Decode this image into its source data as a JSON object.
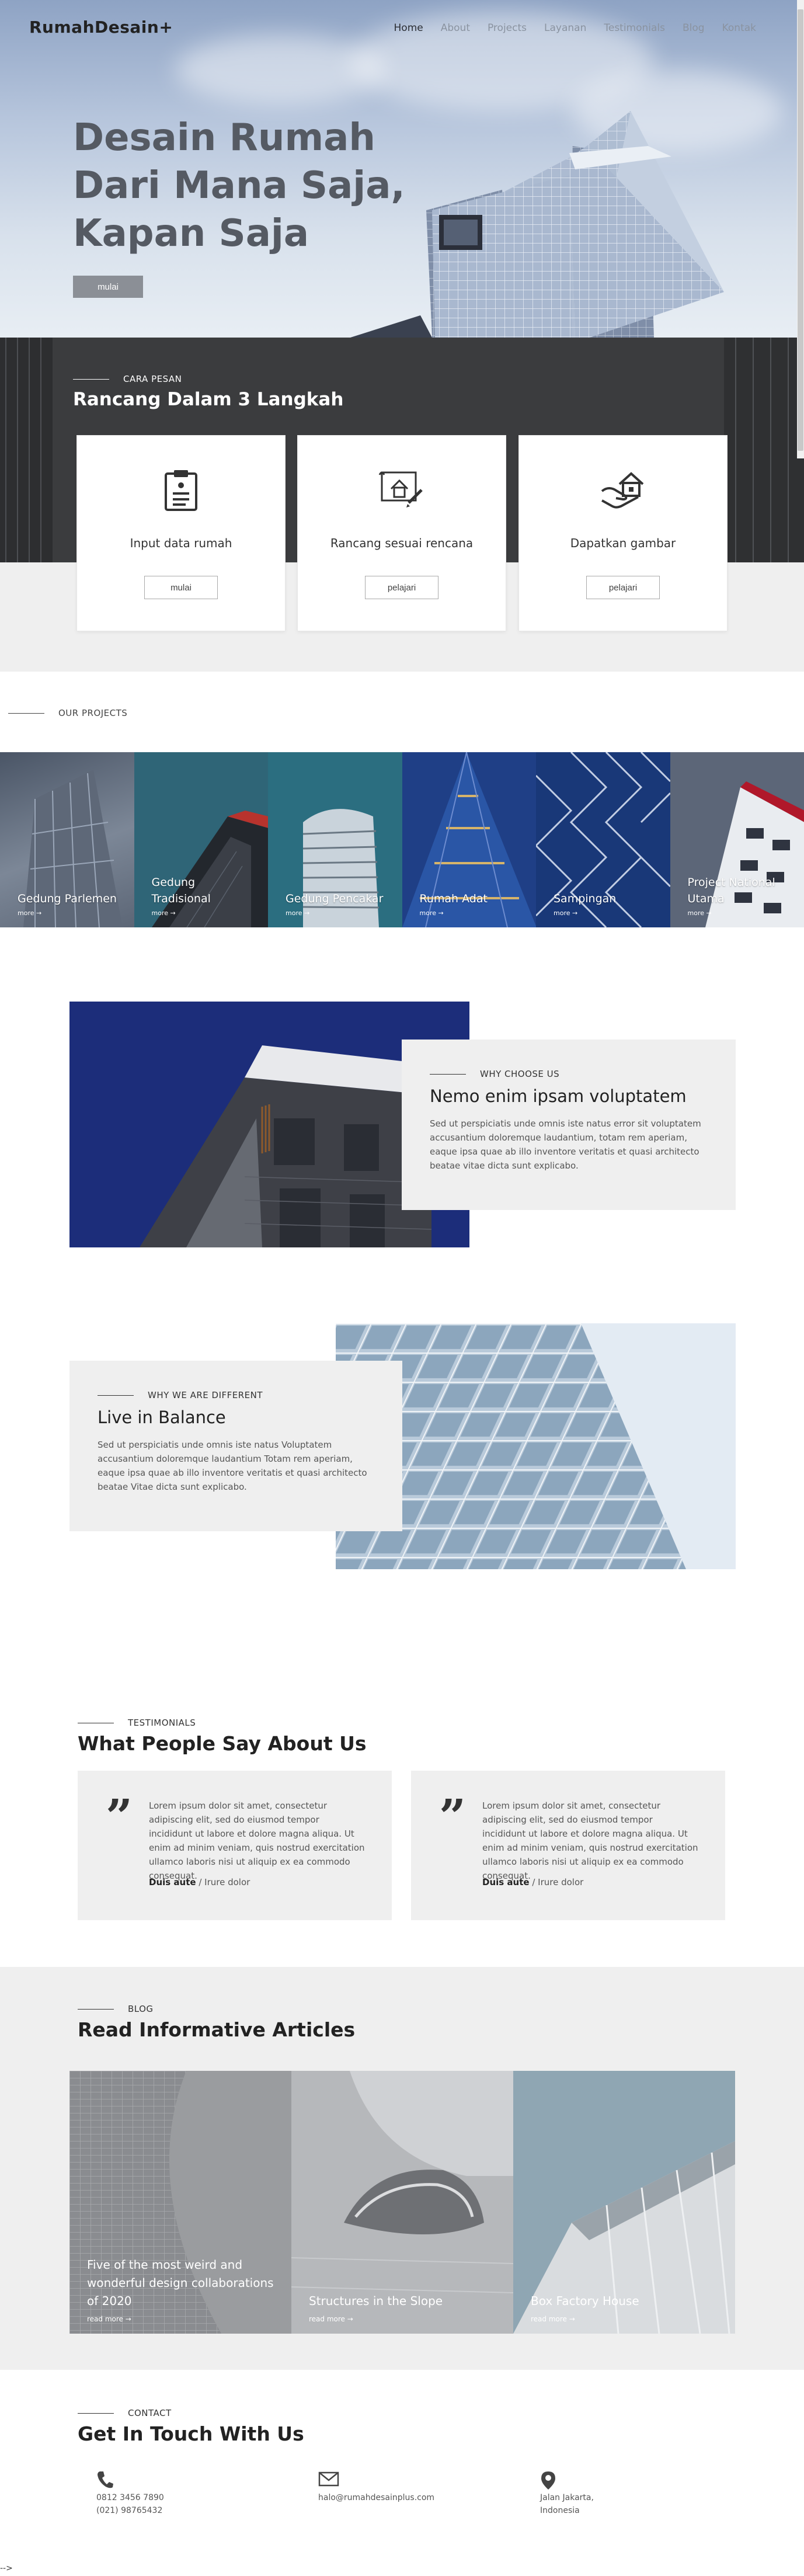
{
  "nav": {
    "logo": "RumahDesain+",
    "items": [
      "Home",
      "About",
      "Projects",
      "Layanan",
      "Testimonials",
      "Blog",
      "Kontak"
    ]
  },
  "hero": {
    "title_l1": "Desain Rumah",
    "title_l2": "Dari Mana Saja,",
    "title_l3": "Kapan Saja",
    "button": "mulai"
  },
  "steps": {
    "eyebrow": "CARA PESAN",
    "title": "Rancang Dalam 3 Langkah",
    "cards": [
      {
        "title": "Input data rumah",
        "button": "mulai",
        "icon": "clipboard-icon"
      },
      {
        "title": "Rancang sesuai rencana",
        "button": "pelajari",
        "icon": "blueprint-house-icon"
      },
      {
        "title": "Dapatkan gambar",
        "button": "pelajari",
        "icon": "hand-house-icon"
      }
    ]
  },
  "projects": {
    "eyebrow": "OUR PROJECTS",
    "more": "more →",
    "items": [
      {
        "l1": "Gedung Parlemen",
        "l2": ""
      },
      {
        "l1": "Gedung",
        "l2": "Tradisional"
      },
      {
        "l1": "Gedung Pencakar",
        "l2": ""
      },
      {
        "l1": "Rumah Adat",
        "l2": ""
      },
      {
        "l1": "Sampingan",
        "l2": ""
      },
      {
        "l1": "Project National",
        "l2": "Utama"
      }
    ]
  },
  "why": {
    "eyebrow": "WHY CHOOSE US",
    "title": "Nemo enim ipsam voluptatem",
    "text": "Sed ut perspiciatis unde omnis iste natus error sit voluptatem accusantium doloremque laudantium, totam rem aperiam, eaque ipsa quae ab illo inventore veritatis et quasi architecto beatae vitae dicta sunt explicabo."
  },
  "different": {
    "eyebrow": "WHY WE ARE DIFFERENT",
    "title": "Live in Balance",
    "text": "Sed ut perspiciatis unde omnis iste natus Voluptatem accusantium doloremque laudantium Totam rem aperiam, eaque ipsa quae ab illo inventore veritatis et quasi architecto beatae Vitae dicta sunt explicabo."
  },
  "testimonials": {
    "eyebrow": "TESTIMONIALS",
    "title": "What People Say About Us",
    "quote_mark": "”",
    "items": [
      {
        "text": "Lorem ipsum dolor sit amet, consectetur adipiscing elit, sed do eiusmod tempor incididunt ut labore et dolore magna aliqua. Ut enim ad minim veniam, quis nostrud exercitation ullamco laboris nisi ut aliquip ex ea commodo consequat.",
        "name": "Duis aute",
        "role": " / Irure dolor"
      },
      {
        "text": "Lorem ipsum dolor sit amet, consectetur adipiscing elit, sed do eiusmod tempor incididunt ut labore et dolore magna aliqua. Ut enim ad minim veniam, quis nostrud exercitation ullamco laboris nisi ut aliquip ex ea commodo consequat.",
        "name": "Duis aute",
        "role": " / Irure dolor"
      }
    ]
  },
  "blog": {
    "eyebrow": "BLOG",
    "title": "Read Informative Articles",
    "more": "read more →",
    "items": [
      {
        "l1": "Five of the most weird and",
        "l2": "wonderful design collaborations",
        "l3": "of 2020"
      },
      {
        "l1": "Structures in the Slope",
        "l2": "",
        "l3": ""
      },
      {
        "l1": "Box Factory House",
        "l2": "",
        "l3": ""
      }
    ]
  },
  "contact": {
    "eyebrow": "CONTACT",
    "title": "Get In Touch With Us",
    "phone1": "0812 3456 7890",
    "phone2": "(021) 98765432",
    "email": "halo@rumahdesainplus.com",
    "addr1": "Jalan Jakarta,",
    "addr2": "Indonesia"
  },
  "footer": {
    "arrow": "-->"
  }
}
